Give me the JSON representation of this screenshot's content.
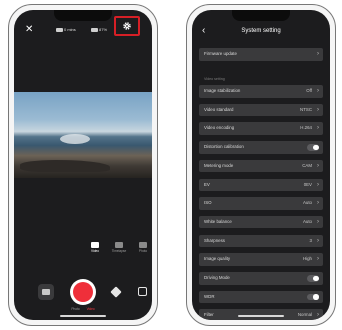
{
  "left_phone": {
    "close_icon": "close-icon",
    "status": {
      "storage": "0 mins",
      "battery": "87%"
    },
    "settings_icon": "gear-icon",
    "modes": [
      {
        "label": "Video",
        "icon": "video-icon",
        "active": true
      },
      {
        "label": "Timelapse",
        "icon": "timelapse-icon",
        "active": false
      },
      {
        "label": "Photo",
        "icon": "photo-icon",
        "active": false
      }
    ],
    "submodes": {
      "first": "Photo",
      "second": "Video"
    },
    "highlight_color": "#d61f26",
    "shutter_color": "#ef2f3a"
  },
  "right_phone": {
    "title": "System setting",
    "firmware": {
      "label": "Firmware update"
    },
    "section_label": "Video setting",
    "rows": [
      {
        "label": "Image stabilization",
        "value": "Off",
        "type": "select"
      },
      {
        "label": "Video standard",
        "value": "NTSC",
        "type": "select"
      },
      {
        "label": "Video encoding",
        "value": "H.264",
        "type": "select"
      },
      {
        "label": "Distortion calibration",
        "value": "",
        "type": "toggle"
      },
      {
        "label": "Metering mode",
        "value": "CAM",
        "type": "select"
      },
      {
        "label": "EV",
        "value": "0EV",
        "type": "select"
      },
      {
        "label": "ISO",
        "value": "Auto",
        "type": "select"
      },
      {
        "label": "White balance",
        "value": "Auto",
        "type": "select"
      },
      {
        "label": "Sharpness",
        "value": "3",
        "type": "select"
      },
      {
        "label": "Image quality",
        "value": "High",
        "type": "select"
      },
      {
        "label": "Driving Mode",
        "value": "",
        "type": "toggle"
      },
      {
        "label": "WDR",
        "value": "",
        "type": "toggle"
      },
      {
        "label": "Filter",
        "value": "Normal",
        "type": "select"
      }
    ]
  }
}
